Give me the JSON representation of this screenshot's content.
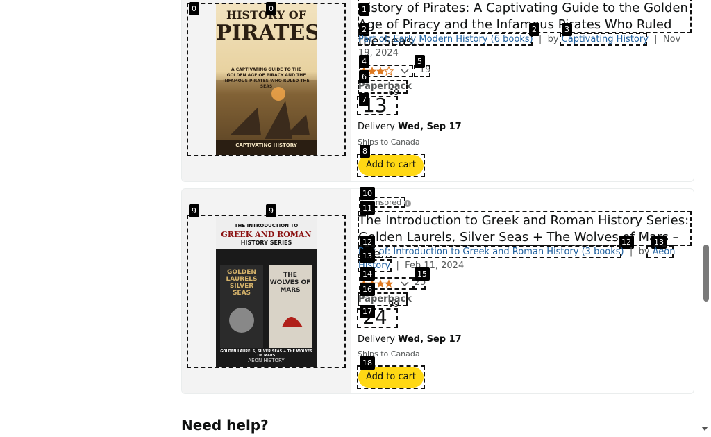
{
  "product1": {
    "cover": {
      "title_line1": "HISTORY OF",
      "title_line2": "PIRATES",
      "subtitle": "A CAPTIVATING GUIDE TO THE GOLDEN AGE OF PIRACY AND THE INFAMOUS PIRATES WHO RULED THE SEAS",
      "brand": "CAPTIVATING HISTORY"
    },
    "title": "History of Pirates: A Captivating Guide to the Golden Age of Piracy and the Infamous Pirates Who Ruled the Seas…",
    "series_prefix": "Part of:",
    "series": "Early Modern History (6 books)",
    "by": "by",
    "author": "Captivating History",
    "date": "Nov 19, 2024",
    "ratings_count": "19",
    "format": "Paperback",
    "price_whole": "13",
    "price_fraction": "69",
    "delivery_label": "Delivery",
    "delivery_date": "Wed, Sep 17",
    "ships": "Ships to Canada",
    "add_to_cart": "Add to cart"
  },
  "product2": {
    "sponsored": "Sponsored",
    "cover": {
      "title_line1": "THE INTRODUCTION TO",
      "title_line2": "GREEK AND ROMAN",
      "title_line3": "HISTORY SERIES",
      "left_title": "GOLDEN LAURELS SILVER SEAS",
      "right_title": "THE WOLVES OF MARS",
      "footer": "GOLDEN LAURELS, SILVER SEAS + THE WOLVES OF MARS",
      "brand": "AEON HISTORY"
    },
    "title": "The Introduction to Greek and Roman History Series: Golden Laurels, Silver Seas + The Wolves of Mars – Gre…",
    "series_prefix": "Part of:",
    "series": "Introduction to Greek and Roman History (3 books)",
    "by": "by",
    "author": "Aeon History",
    "date": "Feb 11, 2024",
    "ratings_count": "25",
    "format": "Paperback",
    "price_whole": "24",
    "price_fraction": "99",
    "delivery_label": "Delivery",
    "delivery_date": "Wed, Sep 17",
    "ships": "Ships to Canada",
    "add_to_cart": "Add to cart"
  },
  "help": {
    "title": "Need help?"
  },
  "tags": [
    "0",
    "1",
    "2",
    "3",
    "4",
    "5",
    "6",
    "7",
    "8",
    "9",
    "10",
    "11",
    "12",
    "13",
    "14",
    "15",
    "16",
    "17",
    "18"
  ],
  "colors": {
    "accent": "#ffd814",
    "link": "#2162a1",
    "star": "#de7921"
  }
}
